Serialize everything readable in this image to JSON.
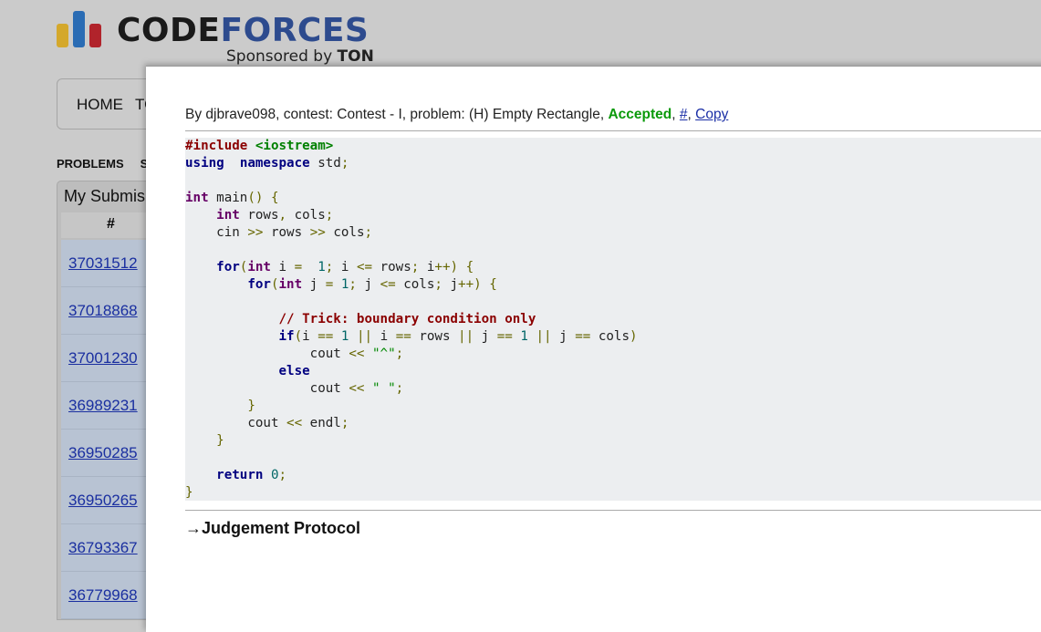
{
  "logo": {
    "code": "CODE",
    "forces": "FORCES",
    "sponsor_prefix": "Sponsored by ",
    "sponsor_name": "TON"
  },
  "menu": {
    "items": [
      "HOME",
      "TO"
    ]
  },
  "subnav": {
    "items": [
      "PROBLEMS",
      "SUE"
    ]
  },
  "submissions_panel": {
    "title": "My Submis",
    "column_header": "#",
    "rows": [
      "37031512",
      "37018868",
      "37001230",
      "36989231",
      "36950285",
      "36950265",
      "36793367",
      "36779968"
    ]
  },
  "submission": {
    "prefix": "By djbrave098, contest: Contest - I, problem: (H) Empty Rectangle, ",
    "verdict": "Accepted",
    "sep1": ", ",
    "hash_link": "#",
    "sep2": ", ",
    "copy_link": "Copy"
  },
  "source_code": [
    [
      [
        "pp",
        "#include "
      ],
      [
        "inc",
        "<iostream>"
      ]
    ],
    [
      [
        "kw",
        "using"
      ],
      [
        "",
        "  "
      ],
      [
        "kw",
        "namespace"
      ],
      [
        "",
        " std"
      ],
      [
        "pun",
        ";"
      ]
    ],
    [],
    [
      [
        "typ",
        "int"
      ],
      [
        "",
        " main"
      ],
      [
        "pun",
        "() {"
      ]
    ],
    [
      [
        "",
        "    "
      ],
      [
        "typ",
        "int"
      ],
      [
        "",
        " rows"
      ],
      [
        "pun",
        ","
      ],
      [
        "",
        " cols"
      ],
      [
        "pun",
        ";"
      ]
    ],
    [
      [
        "",
        "    cin "
      ],
      [
        "pun",
        ">>"
      ],
      [
        "",
        " rows "
      ],
      [
        "pun",
        ">>"
      ],
      [
        "",
        " cols"
      ],
      [
        "pun",
        ";"
      ]
    ],
    [],
    [
      [
        "",
        "    "
      ],
      [
        "kw",
        "for"
      ],
      [
        "pun",
        "("
      ],
      [
        "typ",
        "int"
      ],
      [
        "",
        " i "
      ],
      [
        "pun",
        "="
      ],
      [
        "",
        "  "
      ],
      [
        "num",
        "1"
      ],
      [
        "pun",
        ";"
      ],
      [
        "",
        " i "
      ],
      [
        "pun",
        "<="
      ],
      [
        "",
        " rows"
      ],
      [
        "pun",
        ";"
      ],
      [
        "",
        " i"
      ],
      [
        "pun",
        "++) {"
      ]
    ],
    [
      [
        "",
        "        "
      ],
      [
        "kw",
        "for"
      ],
      [
        "pun",
        "("
      ],
      [
        "typ",
        "int"
      ],
      [
        "",
        " j "
      ],
      [
        "pun",
        "="
      ],
      [
        "",
        " "
      ],
      [
        "num",
        "1"
      ],
      [
        "pun",
        ";"
      ],
      [
        "",
        " j "
      ],
      [
        "pun",
        "<="
      ],
      [
        "",
        " cols"
      ],
      [
        "pun",
        ";"
      ],
      [
        "",
        " j"
      ],
      [
        "pun",
        "++) {"
      ]
    ],
    [],
    [
      [
        "",
        "            "
      ],
      [
        "com",
        "// Trick: boundary condition only"
      ]
    ],
    [
      [
        "",
        "            "
      ],
      [
        "kw",
        "if"
      ],
      [
        "pun",
        "("
      ],
      [
        "",
        "i "
      ],
      [
        "pun",
        "=="
      ],
      [
        "",
        " "
      ],
      [
        "num",
        "1"
      ],
      [
        "",
        " "
      ],
      [
        "pun",
        "||"
      ],
      [
        "",
        " i "
      ],
      [
        "pun",
        "=="
      ],
      [
        "",
        " rows "
      ],
      [
        "pun",
        "||"
      ],
      [
        "",
        " j "
      ],
      [
        "pun",
        "=="
      ],
      [
        "",
        " "
      ],
      [
        "num",
        "1"
      ],
      [
        "",
        " "
      ],
      [
        "pun",
        "||"
      ],
      [
        "",
        " j "
      ],
      [
        "pun",
        "=="
      ],
      [
        "",
        " cols"
      ],
      [
        "pun",
        ")"
      ]
    ],
    [
      [
        "",
        "                cout "
      ],
      [
        "pun",
        "<<"
      ],
      [
        "",
        " "
      ],
      [
        "str",
        "\"^\""
      ],
      [
        "pun",
        ";"
      ]
    ],
    [
      [
        "",
        "            "
      ],
      [
        "kw",
        "else"
      ]
    ],
    [
      [
        "",
        "                cout "
      ],
      [
        "pun",
        "<<"
      ],
      [
        "",
        " "
      ],
      [
        "str",
        "\" \""
      ],
      [
        "pun",
        ";"
      ]
    ],
    [
      [
        "",
        "        "
      ],
      [
        "pun",
        "}"
      ]
    ],
    [
      [
        "",
        "        cout "
      ],
      [
        "pun",
        "<<"
      ],
      [
        "",
        " endl"
      ],
      [
        "pun",
        ";"
      ]
    ],
    [
      [
        "",
        "    "
      ],
      [
        "pun",
        "}"
      ]
    ],
    [],
    [
      [
        "",
        "    "
      ],
      [
        "kw",
        "return"
      ],
      [
        "",
        " "
      ],
      [
        "num",
        "0"
      ],
      [
        "pun",
        ";"
      ]
    ],
    [
      [
        "pun",
        "}"
      ]
    ]
  ],
  "judgement_protocol": "→Judgement Protocol"
}
